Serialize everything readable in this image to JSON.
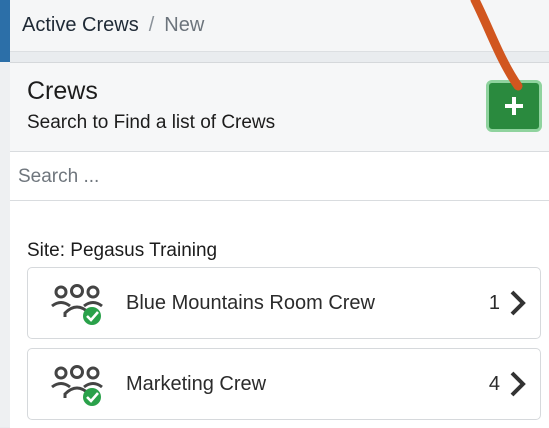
{
  "breadcrumb": {
    "items": [
      "Active Crews",
      "New"
    ],
    "separator": "/"
  },
  "panel": {
    "title": "Crews",
    "subtitle": "Search to Find a list of Crews",
    "add_button_label": "+"
  },
  "search": {
    "placeholder": "Search ...",
    "value": ""
  },
  "site_label": "Site: Pegasus Training",
  "crews": [
    {
      "name": "Blue Mountains Room Crew",
      "count": "1",
      "icon": "crew-group-check-icon"
    },
    {
      "name": "Marketing Crew",
      "count": "4",
      "icon": "crew-group-check-icon"
    }
  ],
  "colors": {
    "accent_green": "#2a8a3e",
    "check_green": "#2aa14a",
    "annotation_orange": "#d1561f",
    "header_blue": "#2c6fa8"
  }
}
